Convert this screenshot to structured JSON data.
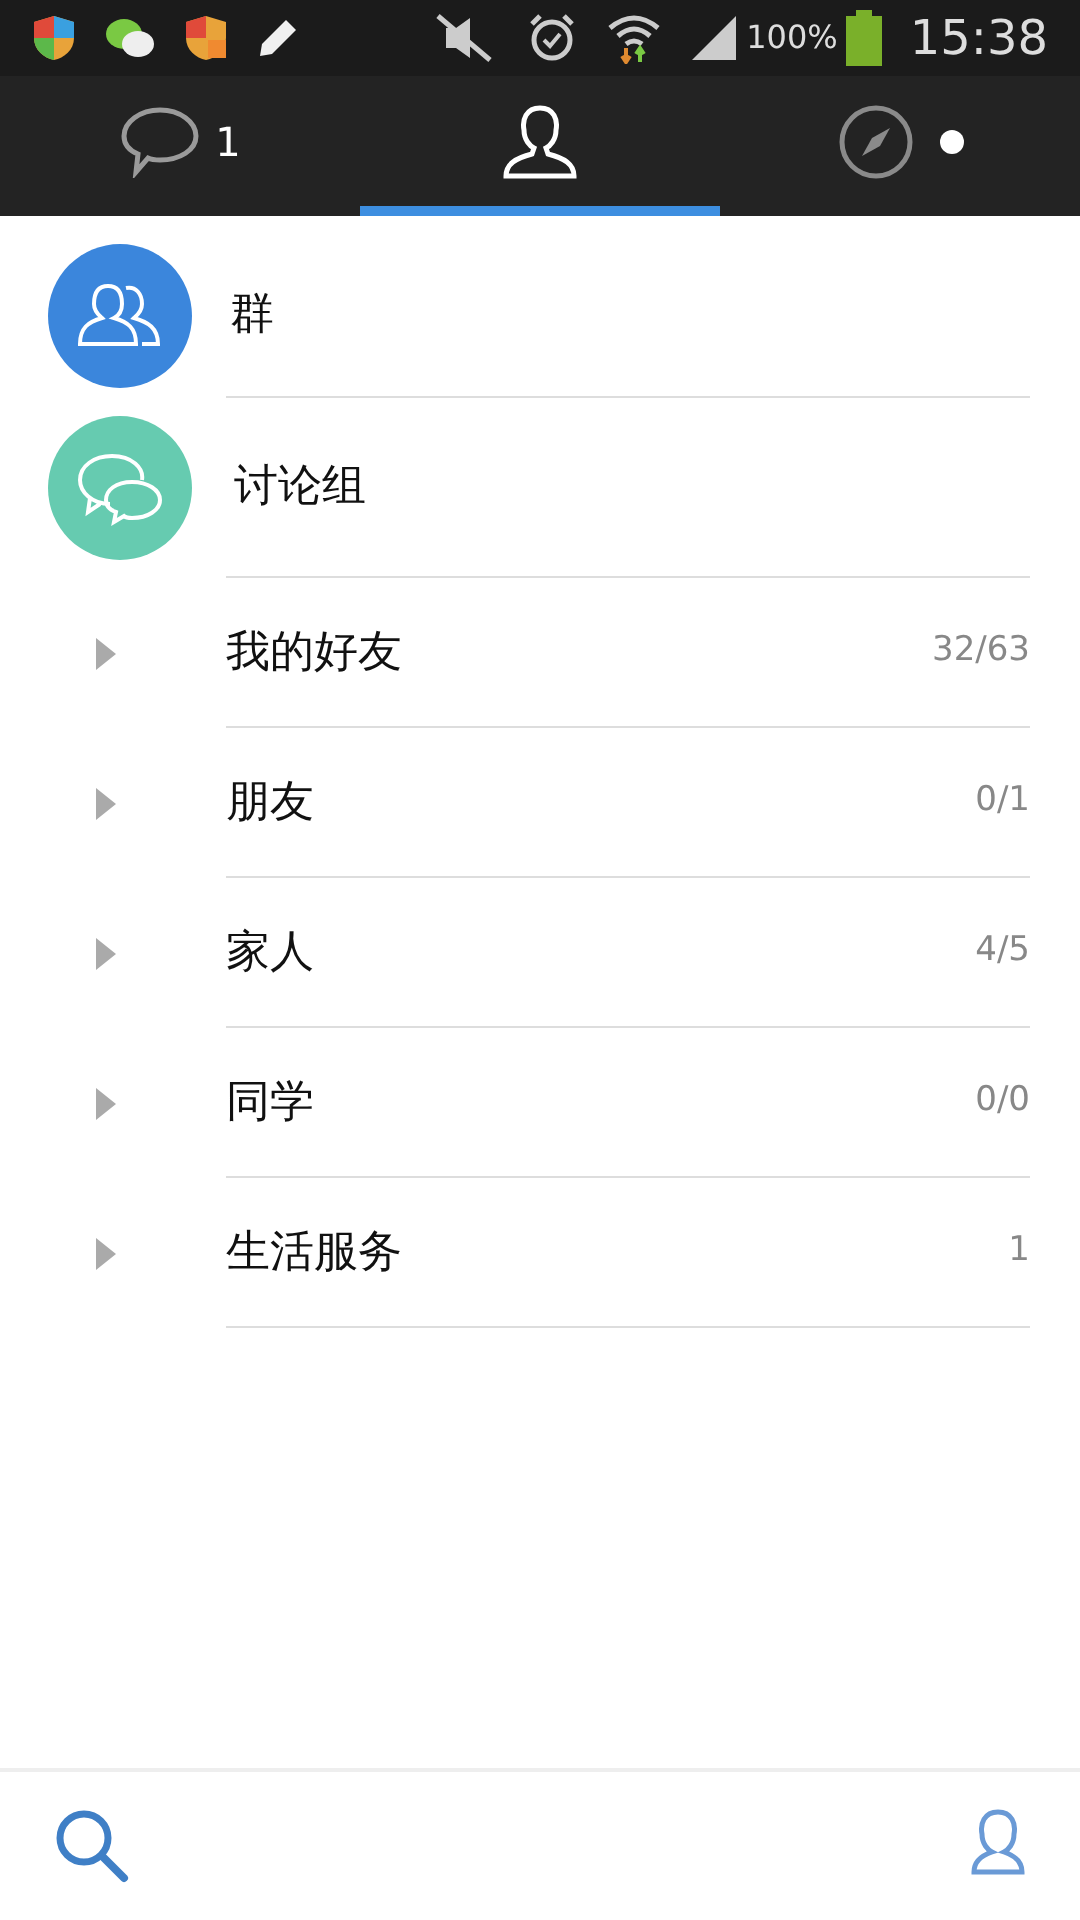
{
  "status_bar": {
    "battery": "100%",
    "time": "15:38"
  },
  "tabs": [
    {
      "kind": "chats",
      "badge": "1",
      "selected": false
    },
    {
      "kind": "contacts",
      "selected": true
    },
    {
      "kind": "discover",
      "selected": false,
      "new_dot": true
    }
  ],
  "entries": [
    {
      "kind": "group",
      "label": "群"
    },
    {
      "kind": "discussion",
      "label": "讨论组"
    }
  ],
  "groups": [
    {
      "label": "我的好友",
      "count": "32/63",
      "expanded": false
    },
    {
      "label": "朋友",
      "count": "0/1",
      "expanded": false
    },
    {
      "label": "家人",
      "count": "4/5",
      "expanded": false
    },
    {
      "label": "同学",
      "count": "0/0",
      "expanded": false
    },
    {
      "label": "生活服务",
      "count": "1",
      "expanded": false
    }
  ]
}
